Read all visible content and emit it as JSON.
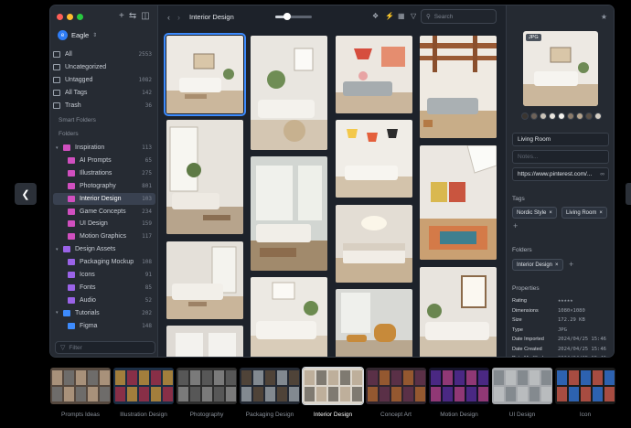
{
  "sidebar": {
    "library_name": "Eagle",
    "smart": [
      {
        "label": "All",
        "count": "2553"
      },
      {
        "label": "Uncategorized",
        "count": ""
      },
      {
        "label": "Untagged",
        "count": "1082"
      },
      {
        "label": "All Tags",
        "count": "142"
      },
      {
        "label": "Trash",
        "count": "36"
      }
    ],
    "smart_folders_label": "Smart Folders",
    "folders_label": "Folders",
    "folders": [
      {
        "label": "Inspiration",
        "count": "113",
        "color": "#d04fbf",
        "level": 0
      },
      {
        "label": "AI Prompts",
        "count": "65",
        "color": "#d04fbf",
        "level": 1
      },
      {
        "label": "Illustrations",
        "count": "275",
        "color": "#d04fbf",
        "level": 1
      },
      {
        "label": "Photography",
        "count": "801",
        "color": "#d04fbf",
        "level": 1
      },
      {
        "label": "Interior Design",
        "count": "103",
        "color": "#d04fbf",
        "level": 1,
        "active": true
      },
      {
        "label": "Game Concepts",
        "count": "234",
        "color": "#d04fbf",
        "level": 1
      },
      {
        "label": "UI Design",
        "count": "159",
        "color": "#d04fbf",
        "level": 1
      },
      {
        "label": "Motion Graphics",
        "count": "117",
        "color": "#d04fbf",
        "level": 1
      },
      {
        "label": "Design Assets",
        "count": "",
        "color": "#9a63e8",
        "level": 0
      },
      {
        "label": "Packaging Mockup",
        "count": "108",
        "color": "#9a63e8",
        "level": 1
      },
      {
        "label": "Icons",
        "count": "91",
        "color": "#9a63e8",
        "level": 1
      },
      {
        "label": "Fonts",
        "count": "85",
        "color": "#9a63e8",
        "level": 1
      },
      {
        "label": "Audio",
        "count": "52",
        "color": "#9a63e8",
        "level": 1
      },
      {
        "label": "Tutorials",
        "count": "202",
        "color": "#3d8bfd",
        "level": 0
      },
      {
        "label": "Figma",
        "count": "148",
        "color": "#3d8bfd",
        "level": 1
      }
    ],
    "filter_placeholder": "Filter"
  },
  "toolbar": {
    "title": "Interior Design",
    "search_placeholder": "Search"
  },
  "inspector": {
    "badge": "JPG",
    "swatches": [
      "#3a3530",
      "#6d6259",
      "#c9c2b8",
      "#e8e4de",
      "#f4f2ee",
      "#8a7a6a",
      "#b5a48e",
      "#5a4f45",
      "#d6cfc5"
    ],
    "name": "Living Room",
    "notes_placeholder": "Notes...",
    "url": "https://www.pinterest.com/...",
    "tags_label": "Tags",
    "tags": [
      "Nordic Style",
      "Living Room"
    ],
    "folders_label": "Folders",
    "folder": "Interior Design",
    "properties_label": "Properties",
    "props": [
      {
        "k": "Rating",
        "v": ""
      },
      {
        "k": "Dimensions",
        "v": "1080×1080"
      },
      {
        "k": "Size",
        "v": "172.29 KB"
      },
      {
        "k": "Type",
        "v": "JPG"
      },
      {
        "k": "Date Imported",
        "v": "2024/04/25 15:46"
      },
      {
        "k": "Date Created",
        "v": "2024/04/25 15:46"
      },
      {
        "k": "Date Modified",
        "v": "2024/04/25 15:46"
      }
    ],
    "rating": 5
  },
  "folders_strip": [
    {
      "label": "Prompts Ideas"
    },
    {
      "label": "Illustration Design"
    },
    {
      "label": "Photography"
    },
    {
      "label": "Packaging Design"
    },
    {
      "label": "Interior Design",
      "active": true
    },
    {
      "label": "Concept Art"
    },
    {
      "label": "Motion Design"
    },
    {
      "label": "UI Design"
    },
    {
      "label": "Icon"
    }
  ]
}
